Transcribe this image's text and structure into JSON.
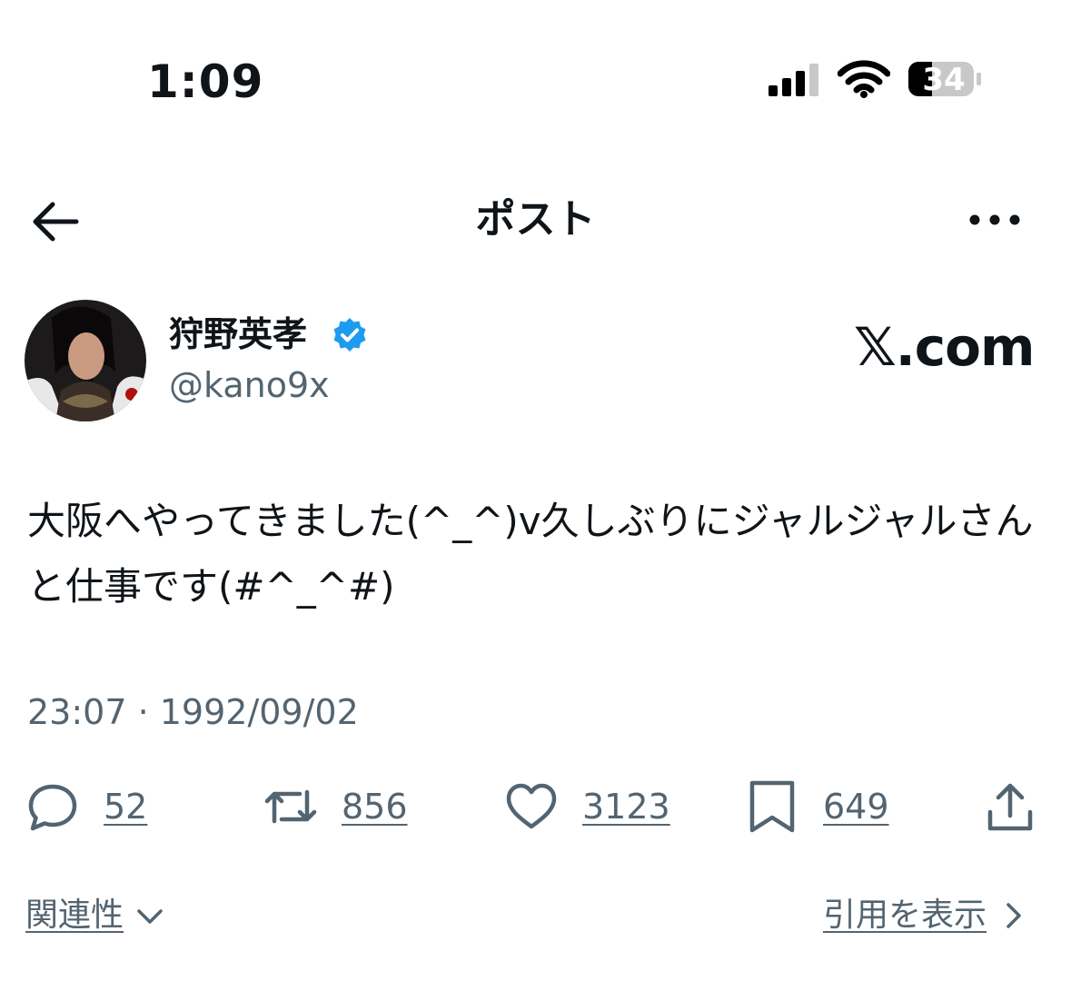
{
  "status_bar": {
    "time": "1:09",
    "battery": "34"
  },
  "header": {
    "title": "ポスト",
    "back_icon": "back-arrow-icon",
    "more_icon": "more-dots-icon"
  },
  "author": {
    "name": "狩野英孝",
    "handle": "@kano9x",
    "verified": true
  },
  "brand": "𝕏.com",
  "tweet": {
    "text": "大阪へやってきました(^_^)v久しぶりにジャルジャルさんと仕事です(#^_^#)",
    "timestamp": "23:07 · 1992/09/02"
  },
  "actions": {
    "reply_count": "52",
    "repost_count": "856",
    "like_count": "3123",
    "bookmark_count": "649"
  },
  "footer": {
    "related": "関連性",
    "view_quotes": "引用を表示"
  },
  "colors": {
    "text": "#0f1419",
    "secondary": "#536471",
    "verified": "#1d9bf0"
  }
}
